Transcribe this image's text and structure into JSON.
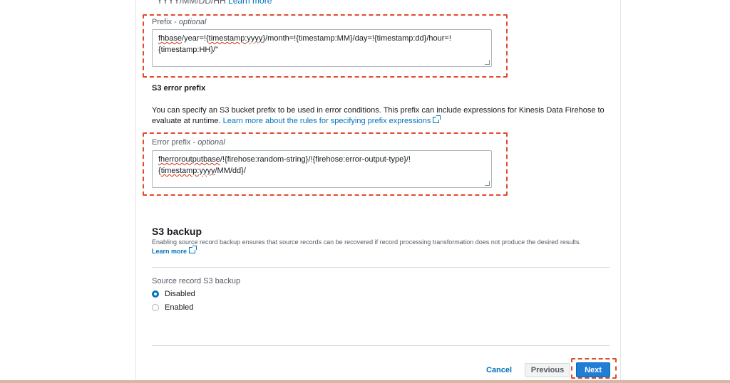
{
  "top": {
    "cut_text": "YYYY/MM/DD/HH",
    "cut_link": "Learn more"
  },
  "prefix": {
    "label": "Prefix - ",
    "label_optional": "optional",
    "value_line1_a": "fhbase",
    "value_line1_b": "/year=!{",
    "value_line1_c": "timestamp:yyyy",
    "value_line1_d": "}/month=!{timestamp:MM}/day=!{timestamp:dd}/hour=!",
    "value_line2": "{timestamp:HH}/\""
  },
  "s3_error_prefix": {
    "heading": "S3 error prefix",
    "desc_line1": "You can specify an S3 bucket prefix to be used in error conditions. This prefix can include expressions for Kinesis Data Firehose to",
    "desc_line2": "evaluate at runtime. ",
    "desc_link": "Learn more about the rules for specifying prefix expressions",
    "label": "Error prefix - ",
    "label_optional": "optional",
    "value_line1_a": "fherroroutputbase",
    "value_line1_b": "/!{firehose:random-string}/!{firehose:error-output-type}/!",
    "value_line2_a": "{",
    "value_line2_b": "timestamp:yyyy",
    "value_line2_c": "/MM/dd}/"
  },
  "s3_backup": {
    "heading": "S3 backup",
    "desc": "Enabling source record backup ensures that source records can be recovered if record processing transformation does not produce the desired results.",
    "learn_more": "Learn more",
    "field_label": "Source record S3 backup",
    "options": [
      {
        "label": "Disabled",
        "selected": true
      },
      {
        "label": "Enabled",
        "selected": false
      }
    ]
  },
  "footer": {
    "cancel": "Cancel",
    "previous": "Previous",
    "next": "Next"
  },
  "colors": {
    "link": "#0073bb",
    "primary_button": "#1f7ed6",
    "highlight_dash": "#e04b2d"
  }
}
